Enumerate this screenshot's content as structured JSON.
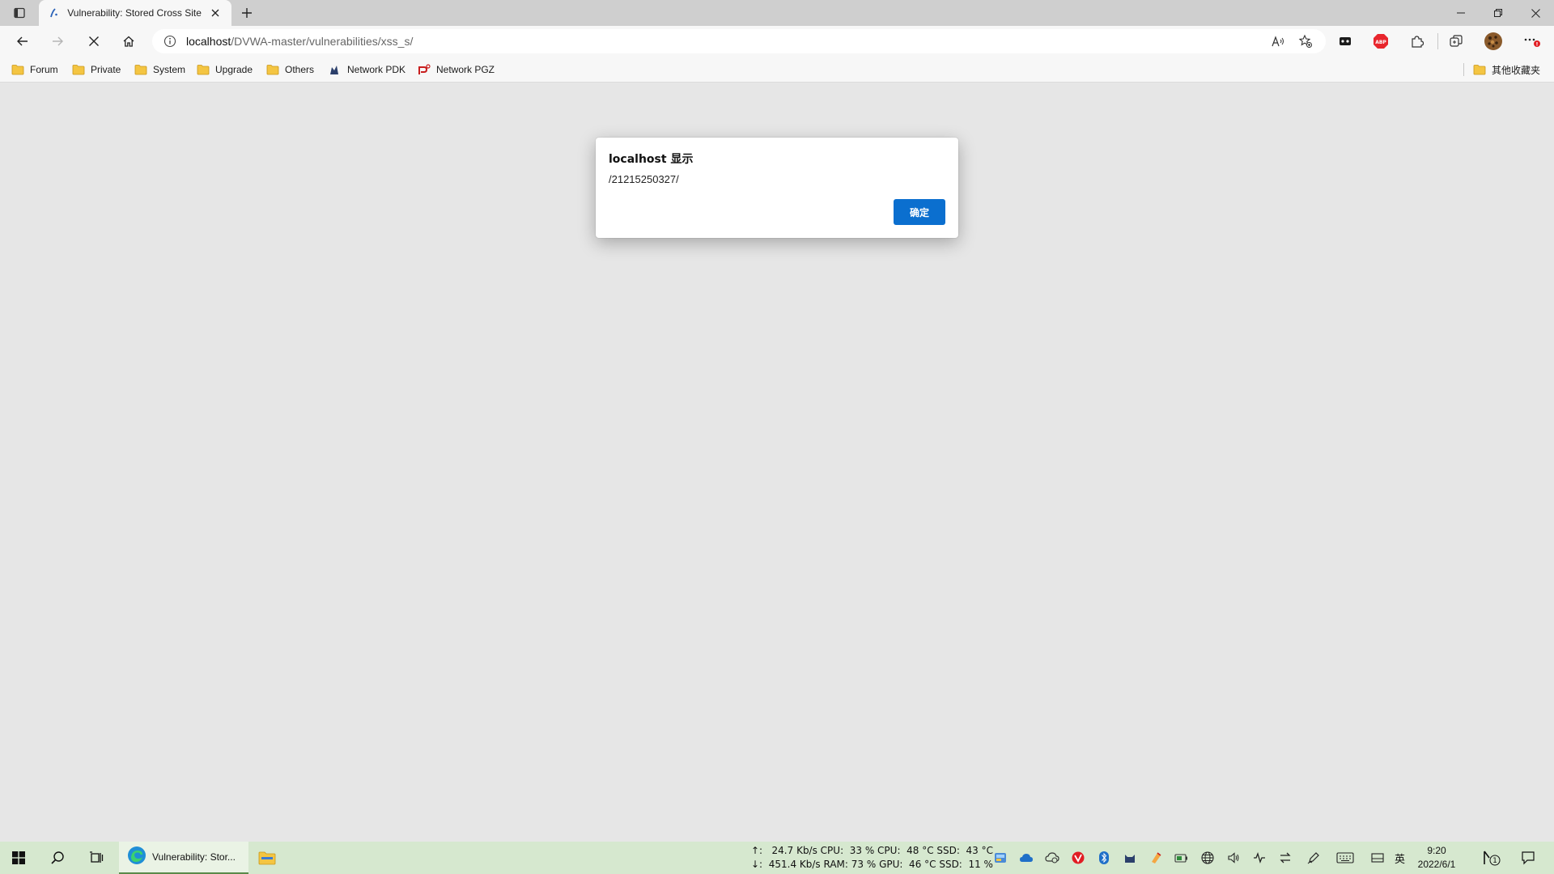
{
  "browser": {
    "tab": {
      "title": "Vulnerability: Stored Cross Site Scripting (XSS)"
    },
    "address": {
      "host": "localhost",
      "path": "/DVWA-master/vulnerabilities/xss_s/"
    },
    "bookmarks": [
      {
        "label": "Forum",
        "icon": "folder-icon"
      },
      {
        "label": "Private",
        "icon": "folder-icon"
      },
      {
        "label": "System",
        "icon": "folder-icon"
      },
      {
        "label": "Upgrade",
        "icon": "folder-icon"
      },
      {
        "label": "Others",
        "icon": "folder-icon"
      },
      {
        "label": "Network PDK",
        "icon": "network-pdk-icon"
      },
      {
        "label": "Network PGZ",
        "icon": "network-pgz-icon"
      }
    ],
    "other_bookmarks": "其他收藏夹",
    "extension_badge": "ABP"
  },
  "dialog": {
    "title": "localhost 显示",
    "message": "/21215250327/",
    "ok_label": "确定"
  },
  "taskbar": {
    "app_label": "Vulnerability: Stor...",
    "stats_line1": "↑:   24.7 Kb/s CPU:  33 % CPU:  48 °C SSD:  43 °C",
    "stats_line2": "↓:  451.4 Kb/s RAM: 73 % GPU:  46 °C SSD:  11 %",
    "ime": "英",
    "time": "9:20",
    "date": "2022/6/1",
    "notification_count": "1"
  },
  "colors": {
    "accent": "#0b6fcf",
    "taskbar": "#d6e8cf",
    "page_bg": "#e6e6e6"
  }
}
